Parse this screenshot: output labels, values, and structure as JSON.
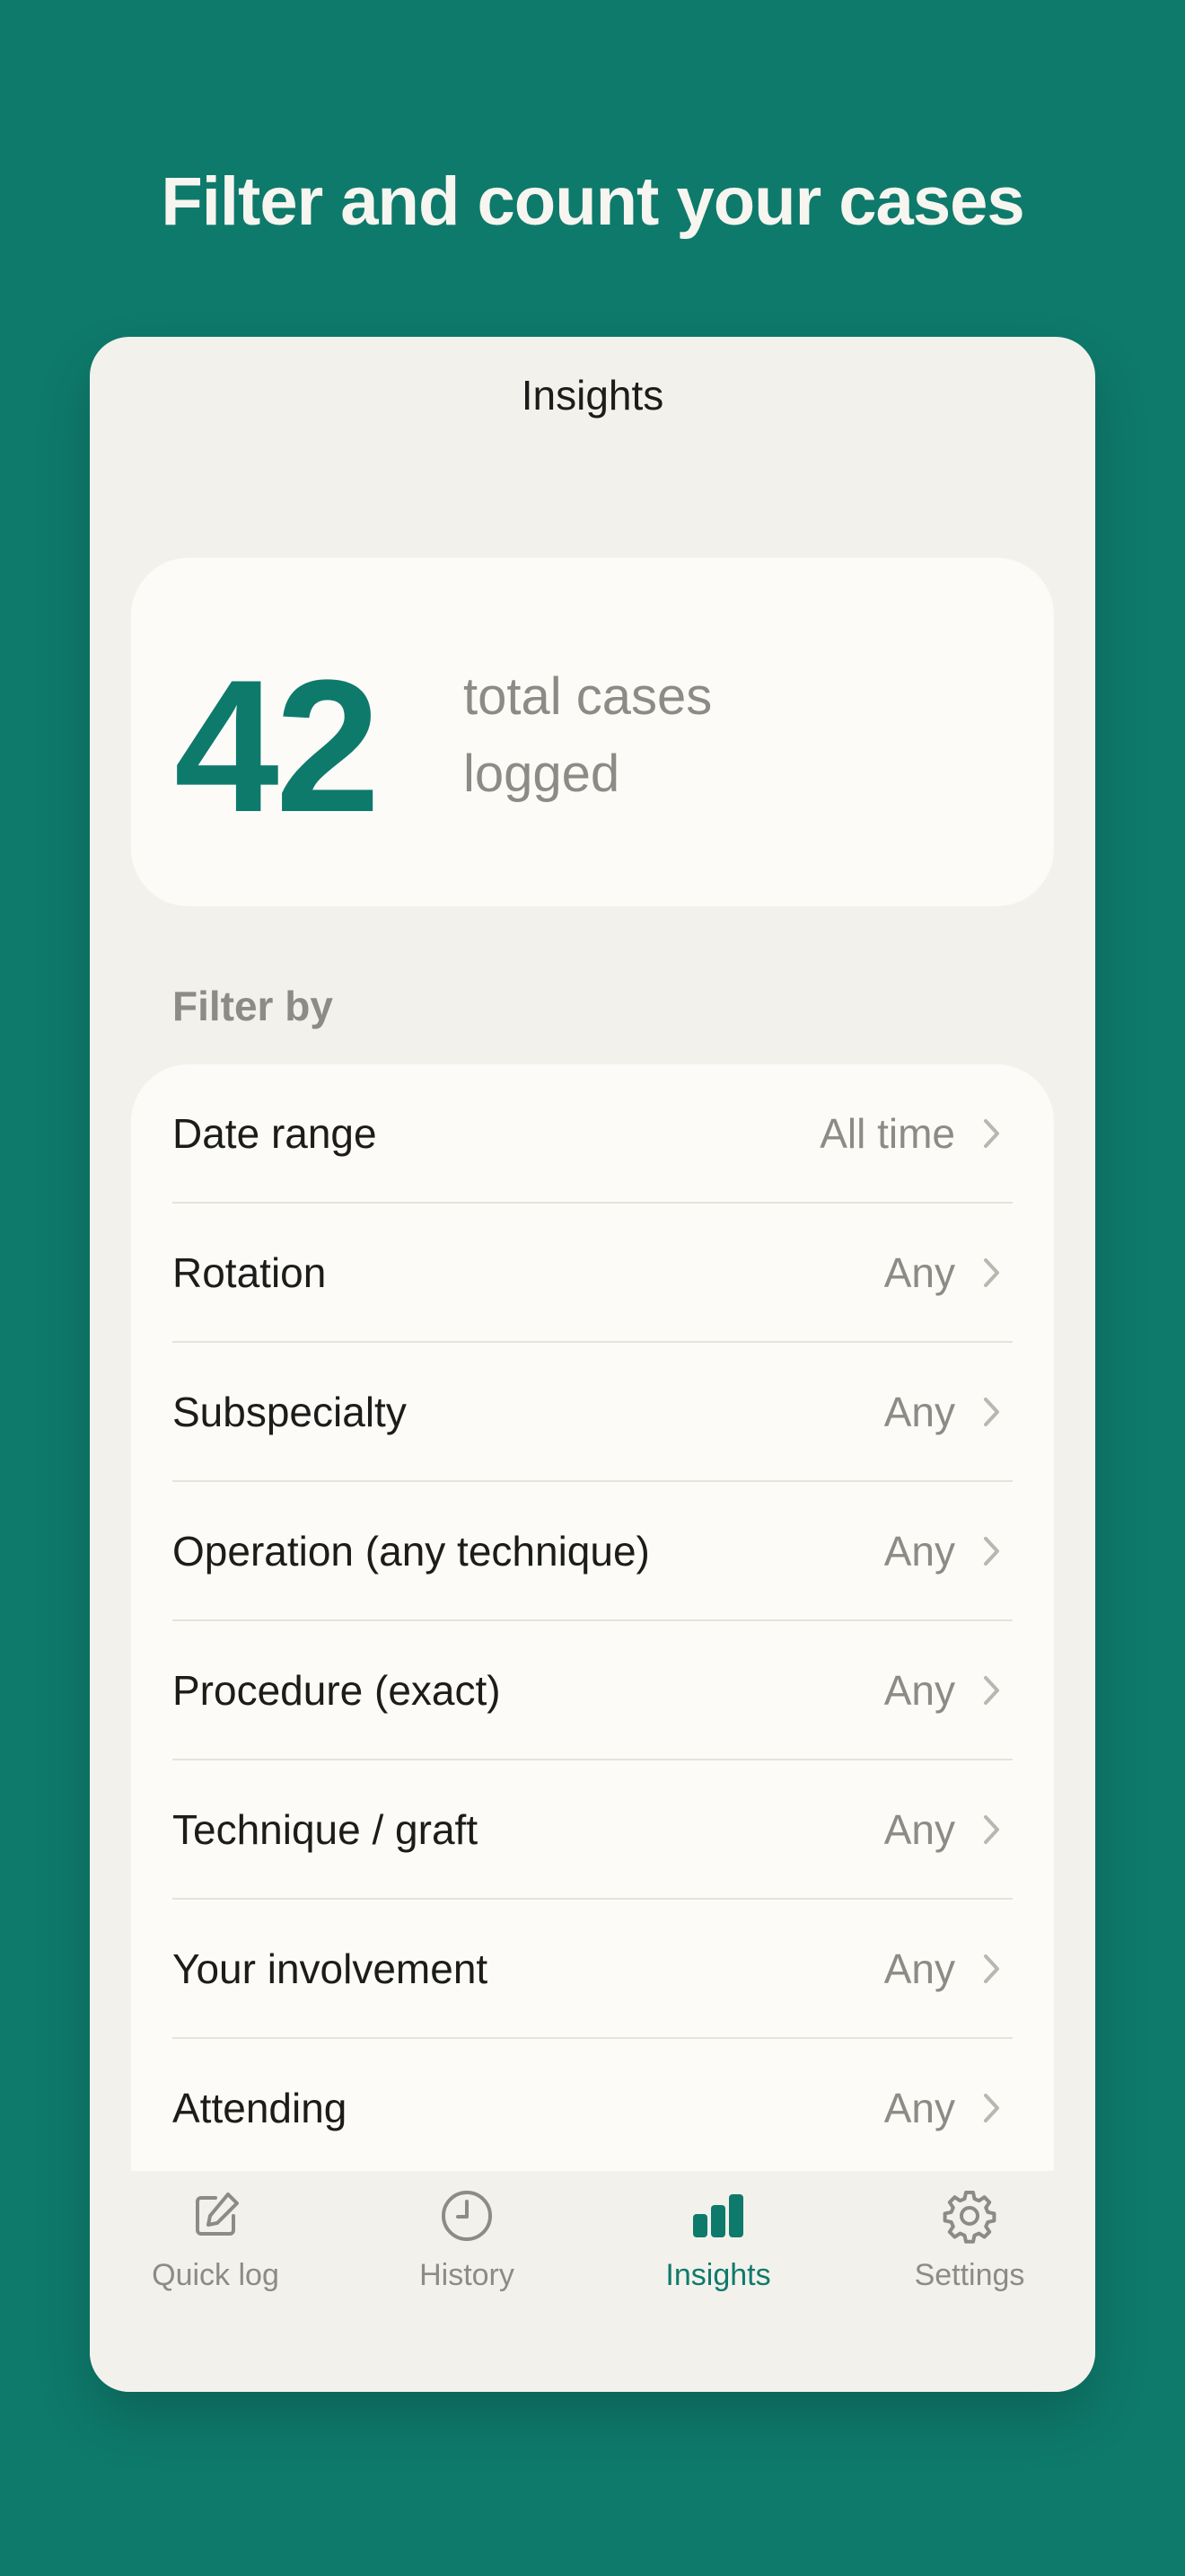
{
  "headline": "Filter and count your cases",
  "screen": {
    "title": "Insights"
  },
  "summary": {
    "count": "42",
    "label": "total cases logged"
  },
  "filters": {
    "section_label": "Filter by",
    "items": [
      {
        "label": "Date range",
        "value": "All time"
      },
      {
        "label": "Rotation",
        "value": "Any"
      },
      {
        "label": "Subspecialty",
        "value": "Any"
      },
      {
        "label": "Operation (any technique)",
        "value": "Any"
      },
      {
        "label": "Procedure (exact)",
        "value": "Any"
      },
      {
        "label": "Technique / graft",
        "value": "Any"
      },
      {
        "label": "Your involvement",
        "value": "Any"
      },
      {
        "label": "Attending",
        "value": "Any"
      }
    ]
  },
  "tabbar": {
    "tabs": [
      {
        "label": "Quick log",
        "icon": "edit-icon",
        "active": false
      },
      {
        "label": "History",
        "icon": "clock-icon",
        "active": false
      },
      {
        "label": "Insights",
        "icon": "bar-chart-icon",
        "active": true
      },
      {
        "label": "Settings",
        "icon": "gear-icon",
        "active": false
      }
    ]
  },
  "colors": {
    "brand": "#0e7a6b",
    "background": "#f3f1ec",
    "card": "#fcfbf8",
    "muted_text": "#8c8b85",
    "primary_text": "#1c1c1a"
  }
}
